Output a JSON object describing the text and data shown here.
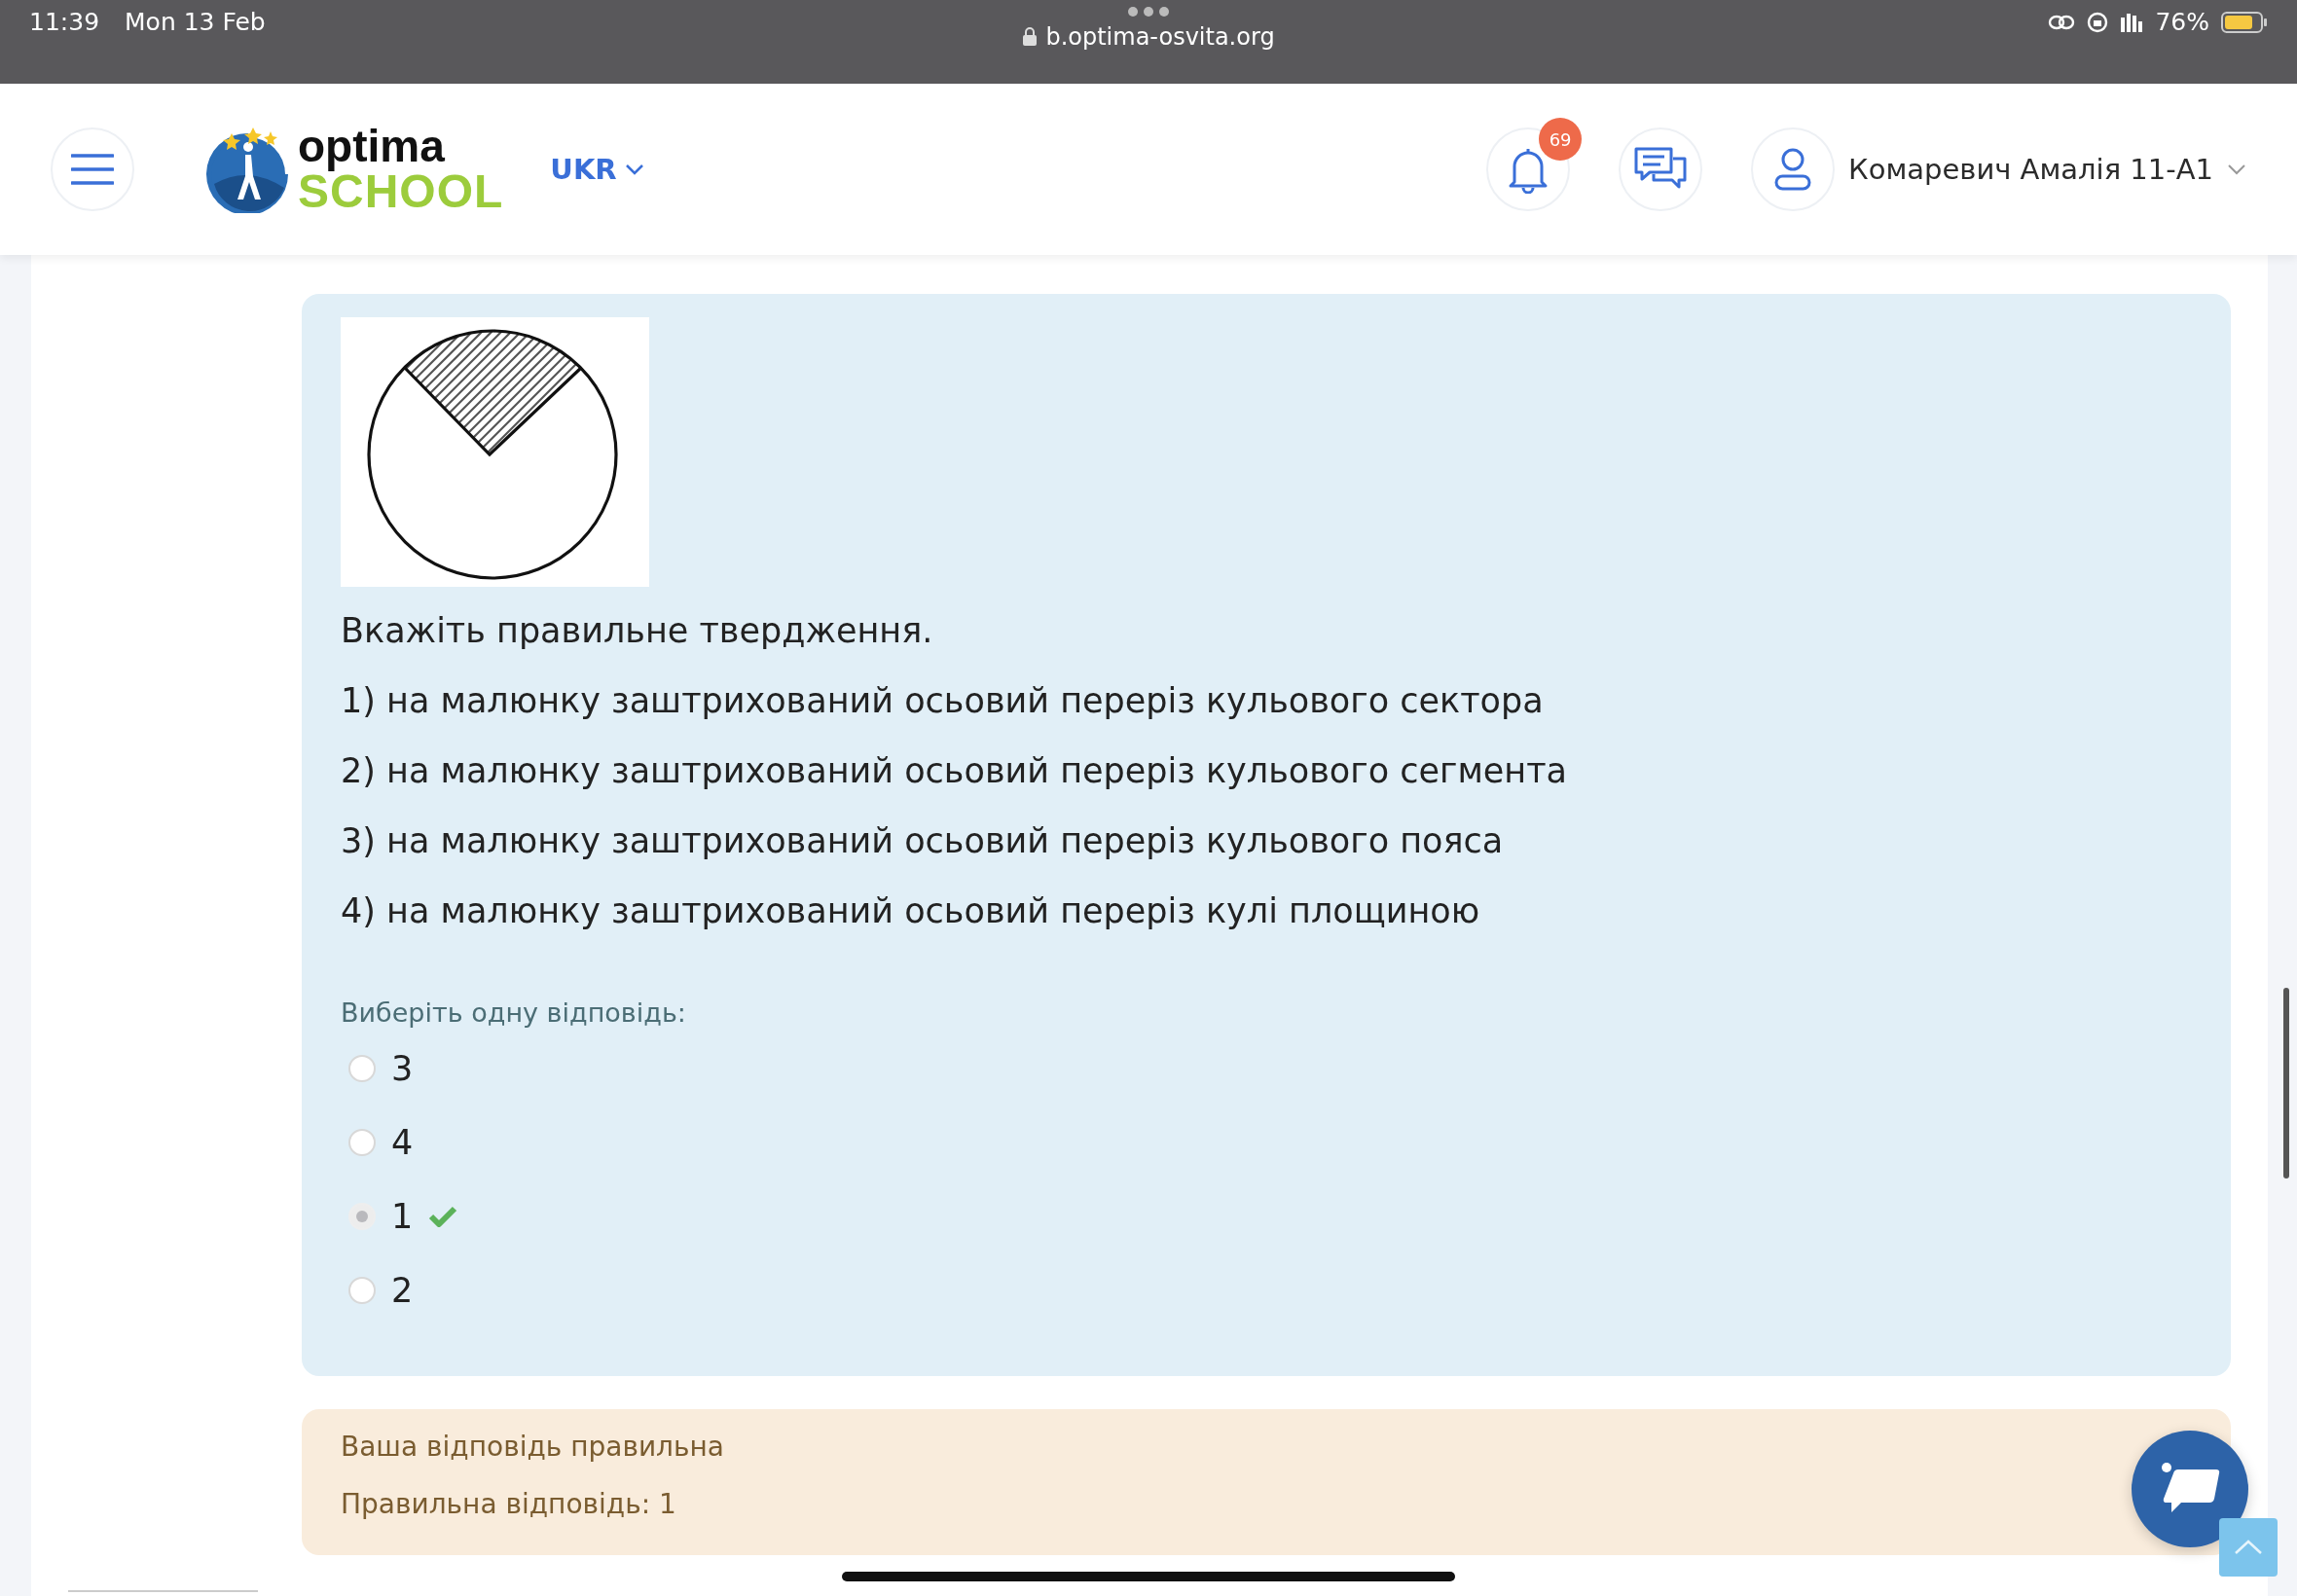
{
  "status_bar": {
    "time": "11:39",
    "date": "Mon 13 Feb",
    "url": "b.optima-osvita.org",
    "battery": "76%"
  },
  "header": {
    "logo_top": "optima",
    "logo_bottom": "SCHOOL",
    "language": "UKR",
    "notifications_badge": "69",
    "user_name": "Комаревич Амалія 11-А1"
  },
  "question": {
    "prompt": "Вкажіть правильне твердження.",
    "statements": [
      "1) на малюнку заштрихований осьовий переріз кульового сектора",
      "2) на малюнку заштрихований осьовий переріз кульового сегмента",
      "3) на малюнку заштрихований осьовий переріз кульового пояса",
      "4) на малюнку заштрихований осьовий переріз кулі площиною"
    ],
    "instruction": "Виберіть одну відповідь:",
    "options": [
      {
        "label": "3",
        "selected": false,
        "correct": false
      },
      {
        "label": "4",
        "selected": false,
        "correct": false
      },
      {
        "label": "1",
        "selected": true,
        "correct": true
      },
      {
        "label": "2",
        "selected": false,
        "correct": false
      }
    ]
  },
  "feedback": {
    "result": "Ваша відповідь правильна",
    "correct_answer": "Правильна відповідь: 1"
  }
}
